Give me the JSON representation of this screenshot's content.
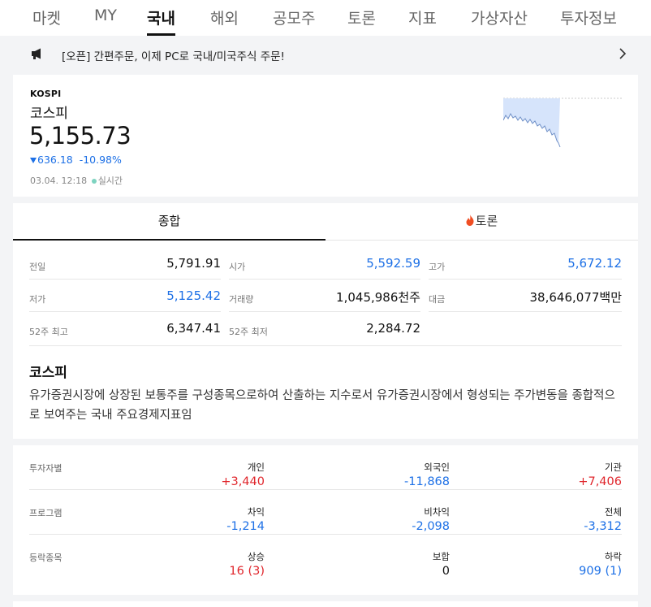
{
  "tabs": [
    "마켓",
    "MY",
    "국내",
    "해외",
    "공모주",
    "토론",
    "지표",
    "가상자산",
    "투자정보"
  ],
  "active_tab": "국내",
  "notice": {
    "text": "[오픈] 간편주문, 이제 PC로 국내/미국주식 주문!"
  },
  "index": {
    "code": "KOSPI",
    "name": "코스피",
    "price": "5,155.73",
    "change": "636.18",
    "change_pct": "-10.98%",
    "timestamp": "03.04. 12:18",
    "realtime": "실시간"
  },
  "sub_tabs": {
    "summary": "종합",
    "discussion": "토론"
  },
  "stats": [
    [
      {
        "label": "전일",
        "value": "5,791.91",
        "color": "#111111"
      },
      {
        "label": "시가",
        "value": "5,592.59",
        "color": "#1d70e6"
      },
      {
        "label": "고가",
        "value": "5,672.12",
        "color": "#1d70e6"
      }
    ],
    [
      {
        "label": "저가",
        "value": "5,125.42",
        "color": "#1d70e6"
      },
      {
        "label": "거래량",
        "value": "1,045,986천주",
        "color": "#111111"
      },
      {
        "label": "대금",
        "value": "38,646,077백만",
        "color": "#111111"
      }
    ],
    [
      {
        "label": "52주 최고",
        "value": "6,347.41",
        "color": "#111111"
      },
      {
        "label": "52주 최저",
        "value": "2,284.72",
        "color": "#111111"
      }
    ]
  ],
  "description": {
    "title": "코스피",
    "body": "유가증권시장에 상장된 보통주를 구성종목으로하여 산출하는 지수로서 유가증권시장에서 형성되는 주가변동을 종합적으로 보여주는 국내 주요경제지표임"
  },
  "investors": [
    {
      "header": "투자자별",
      "cols": [
        {
          "k": "개인",
          "v": "+3,440",
          "color": "#e0262c"
        },
        {
          "k": "외국인",
          "v": "-11,868",
          "color": "#1d70e6"
        },
        {
          "k": "기관",
          "v": "+7,406",
          "color": "#e0262c"
        }
      ]
    },
    {
      "header": "프로그램",
      "cols": [
        {
          "k": "차익",
          "v": "-1,214",
          "color": "#1d70e6"
        },
        {
          "k": "비차익",
          "v": "-2,098",
          "color": "#1d70e6"
        },
        {
          "k": "전체",
          "v": "-3,312",
          "color": "#1d70e6"
        }
      ]
    },
    {
      "header": "등락종목",
      "cols": [
        {
          "k": "상승",
          "v": "16 (3)",
          "color": "#e0262c"
        },
        {
          "k": "보합",
          "v": "0",
          "color": "#111111"
        },
        {
          "k": "하락",
          "v": "909 (1)",
          "color": "#1d70e6"
        }
      ]
    }
  ],
  "colors": {
    "up": "#e0262c",
    "down": "#1d70e6",
    "chart_fill": "#d6e4fb"
  }
}
